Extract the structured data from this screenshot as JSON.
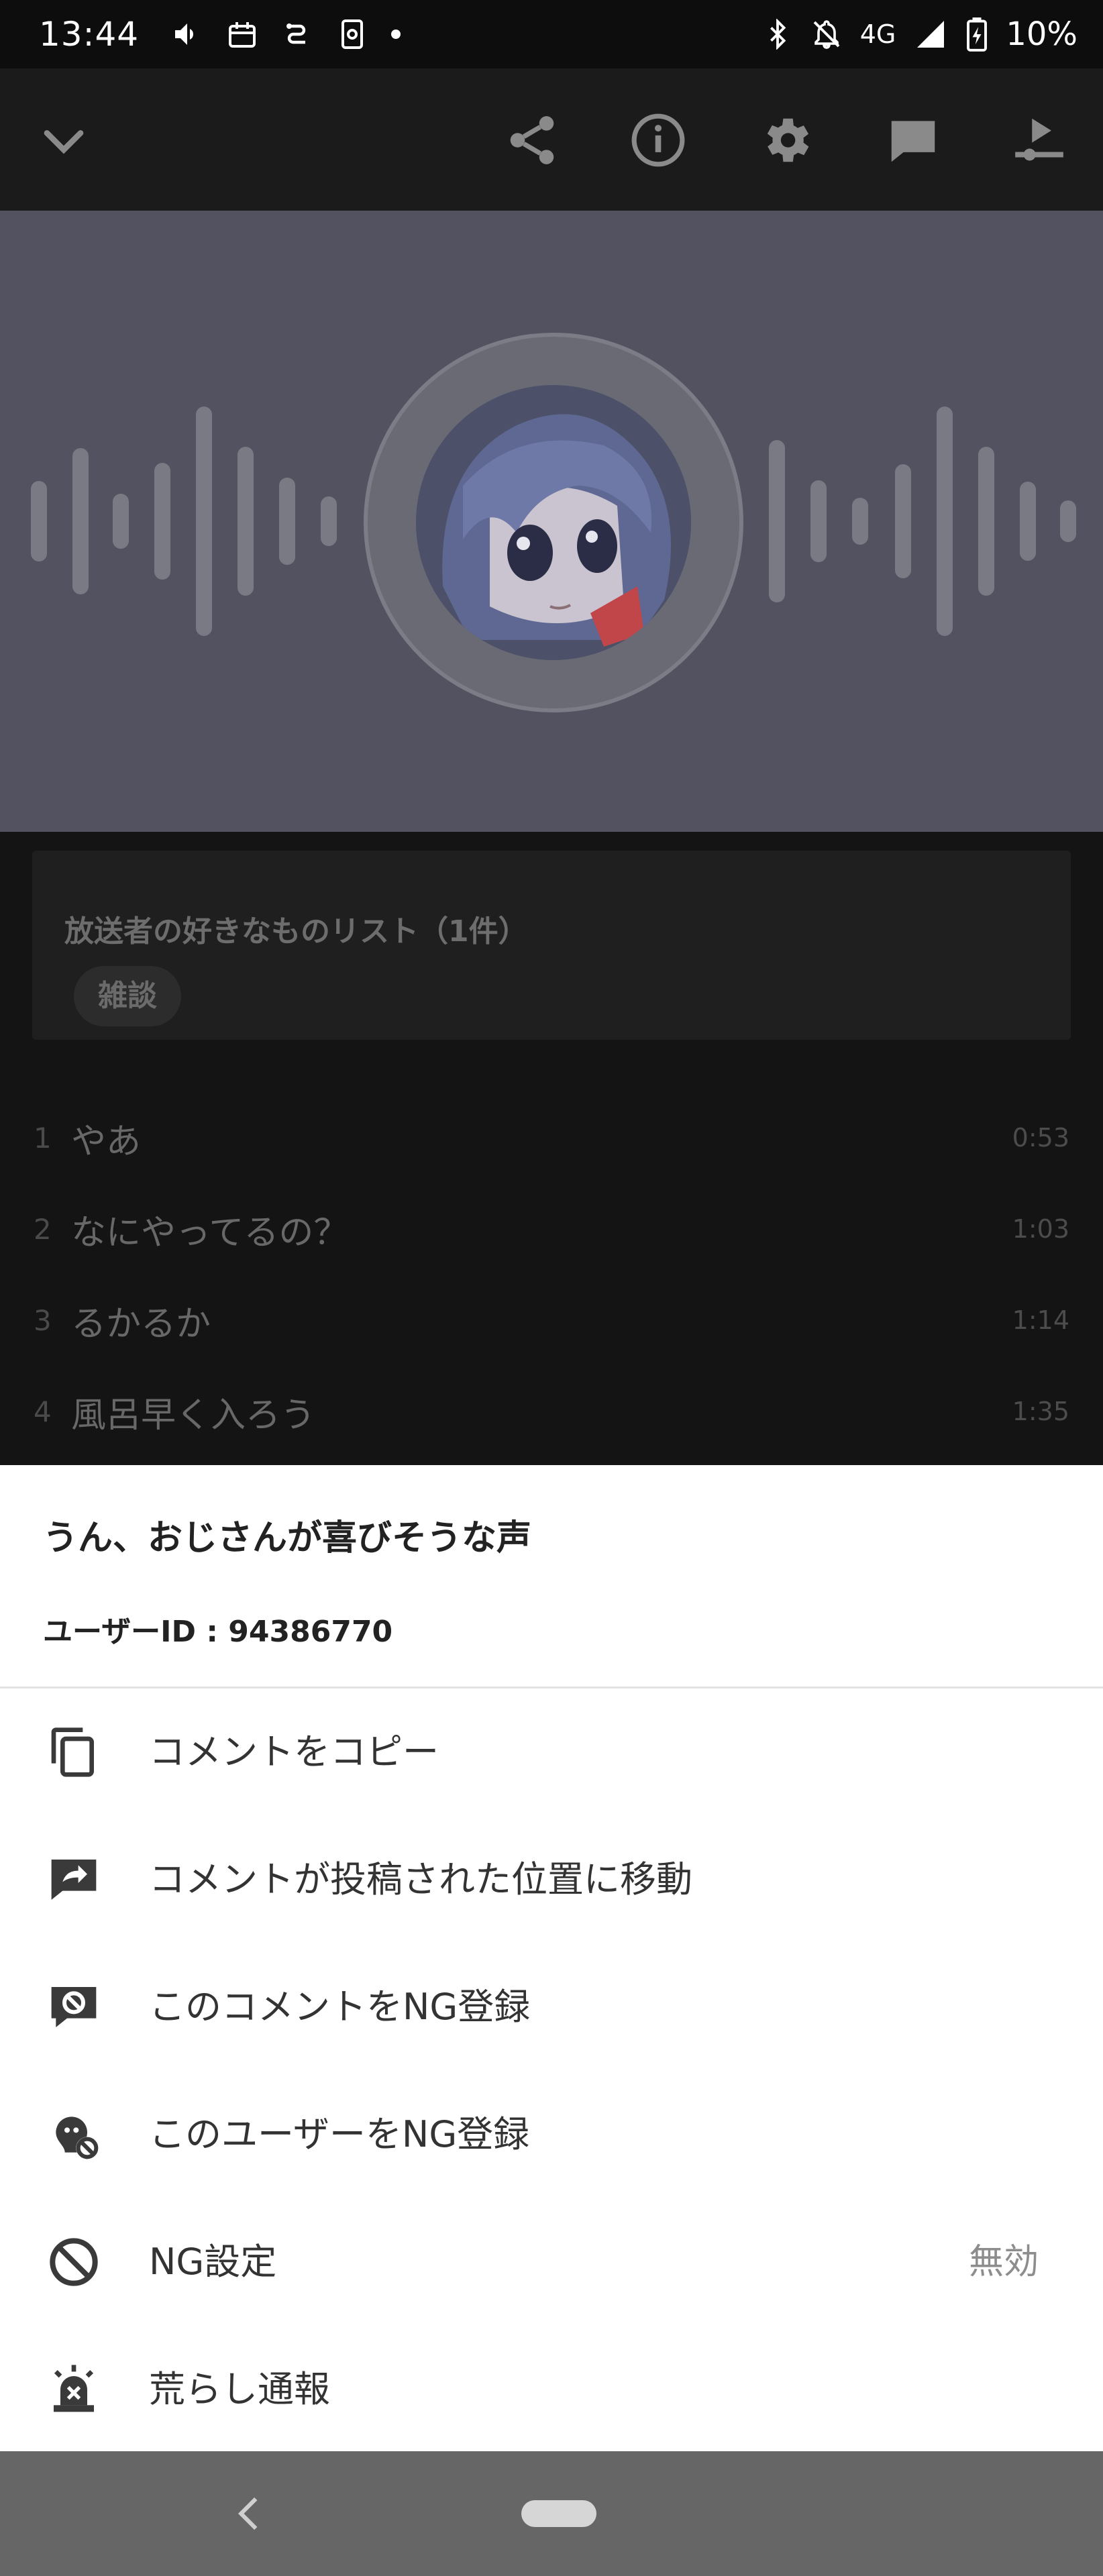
{
  "status_bar": {
    "time": "13:44",
    "network": "4G",
    "battery": "10%"
  },
  "playlist": {
    "title": "放送者の好きなものリスト（1件）",
    "tag": "雑談",
    "tracks": [
      {
        "num": "1",
        "title": "やあ",
        "duration": "0:53"
      },
      {
        "num": "2",
        "title": "なにやってるの？",
        "duration": "1:03"
      },
      {
        "num": "3",
        "title": "るかるか",
        "duration": "1:14"
      },
      {
        "num": "4",
        "title": "風呂早く入ろう",
        "duration": "1:35"
      }
    ]
  },
  "sheet": {
    "comment": "うん、おじさんが喜びそうな声",
    "user_id": "ユーザーID : 94386770",
    "items": [
      {
        "label": "コメントをコピー",
        "icon": "copy-icon"
      },
      {
        "label": "コメントが投稿された位置に移動",
        "icon": "comment-jump-icon"
      },
      {
        "label": "このコメントをNG登録",
        "icon": "comment-block-icon"
      },
      {
        "label": "このユーザーをNG登録",
        "icon": "user-block-icon"
      },
      {
        "label": "NG設定",
        "icon": "block-icon",
        "value": "無効"
      },
      {
        "label": "荒らし通報",
        "icon": "alarm-report-icon"
      }
    ]
  },
  "colors": {
    "player_bg": "#525261",
    "sheet_bg": "#ffffff",
    "navbar_bg": "#666666"
  }
}
